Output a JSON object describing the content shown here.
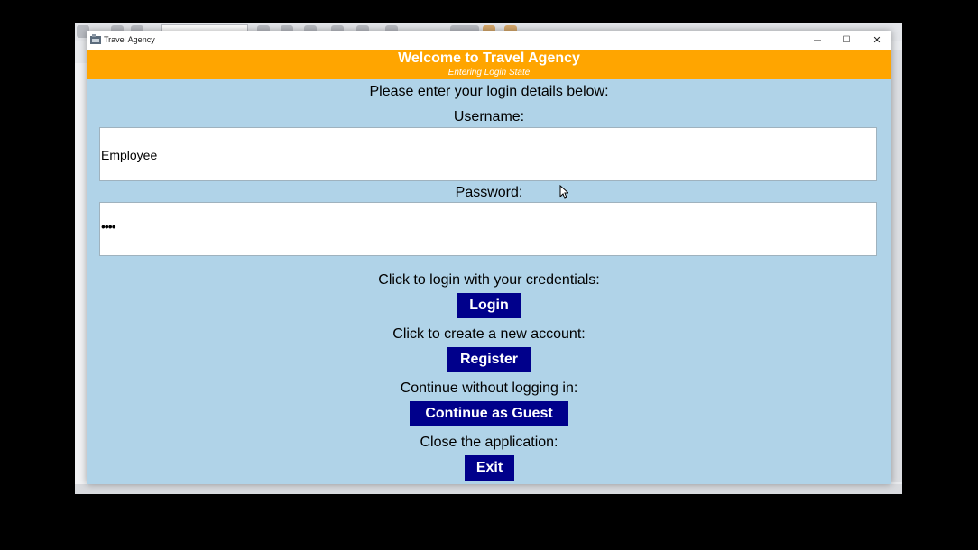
{
  "window": {
    "title": "Travel Agency",
    "controls": {
      "minimize": "—",
      "maximize": "☐",
      "close": "✕"
    }
  },
  "banner": {
    "title": "Welcome to Travel Agency",
    "subtitle": "Entering Login State"
  },
  "form": {
    "instruction": "Please enter your login details below:",
    "username_label": "Username:",
    "username_value": "Employee",
    "password_label": "Password:",
    "password_value": "••••"
  },
  "actions": {
    "login_prompt": "Click to login with your credentials:",
    "login_button": "Login",
    "register_prompt": "Click to create a new account:",
    "register_button": "Register",
    "guest_prompt": "Continue without logging in:",
    "guest_button": "Continue as Guest",
    "exit_prompt": "Close the application:",
    "exit_button": "Exit"
  },
  "colors": {
    "banner": "#ffa500",
    "body": "#b0d3e8",
    "button": "#00008b"
  }
}
